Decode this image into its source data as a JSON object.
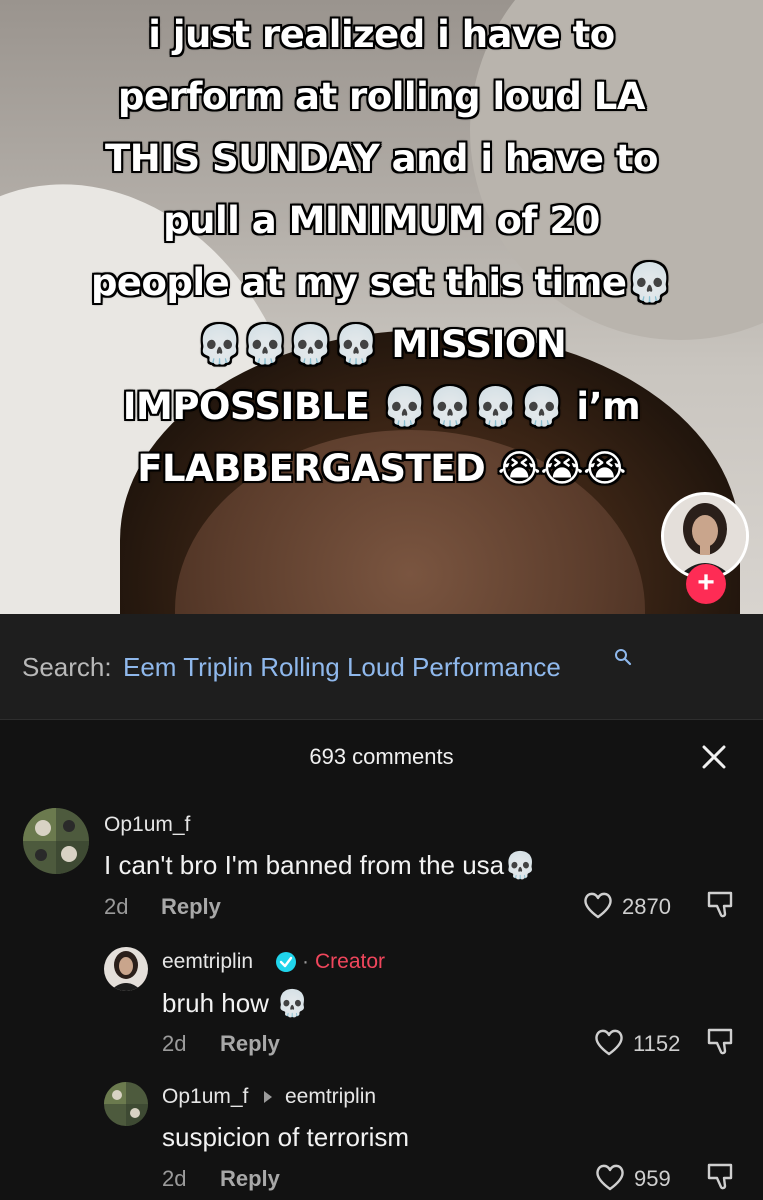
{
  "video": {
    "caption_lines": [
      "i just realized i have to",
      "perform at rolling loud LA",
      "THIS SUNDAY and i have to",
      "pull a MINIMUM of 20",
      "people at my set this time💀",
      "💀💀💀💀 MISSION",
      "IMPOSSIBLE 💀💀💀💀 i’m",
      "FLABBERGASTED 😭😭😭"
    ],
    "follow_label": "+"
  },
  "search": {
    "label": "Search:",
    "query": "Eem Triplin Rolling Loud Performance"
  },
  "comments_header": {
    "count_text": "693 comments"
  },
  "comments": [
    {
      "username": "Op1um_f",
      "text": "I can't bro I'm banned from the usa💀",
      "age": "2d",
      "reply_label": "Reply",
      "likes": "2870"
    },
    {
      "username": "eemtriplin",
      "separator": "·",
      "creator_label": "Creator",
      "text": "bruh how 💀",
      "age": "2d",
      "reply_label": "Reply",
      "likes": "1152"
    },
    {
      "username": "Op1um_f",
      "reply_to": "eemtriplin",
      "text": "suspicion of terrorism",
      "age": "2d",
      "reply_label": "Reply",
      "likes": "959"
    }
  ],
  "colors": {
    "accent": "#fe2c55",
    "link": "#8fb8ec",
    "creator": "#f0465c",
    "verified": "#20d5ec"
  }
}
